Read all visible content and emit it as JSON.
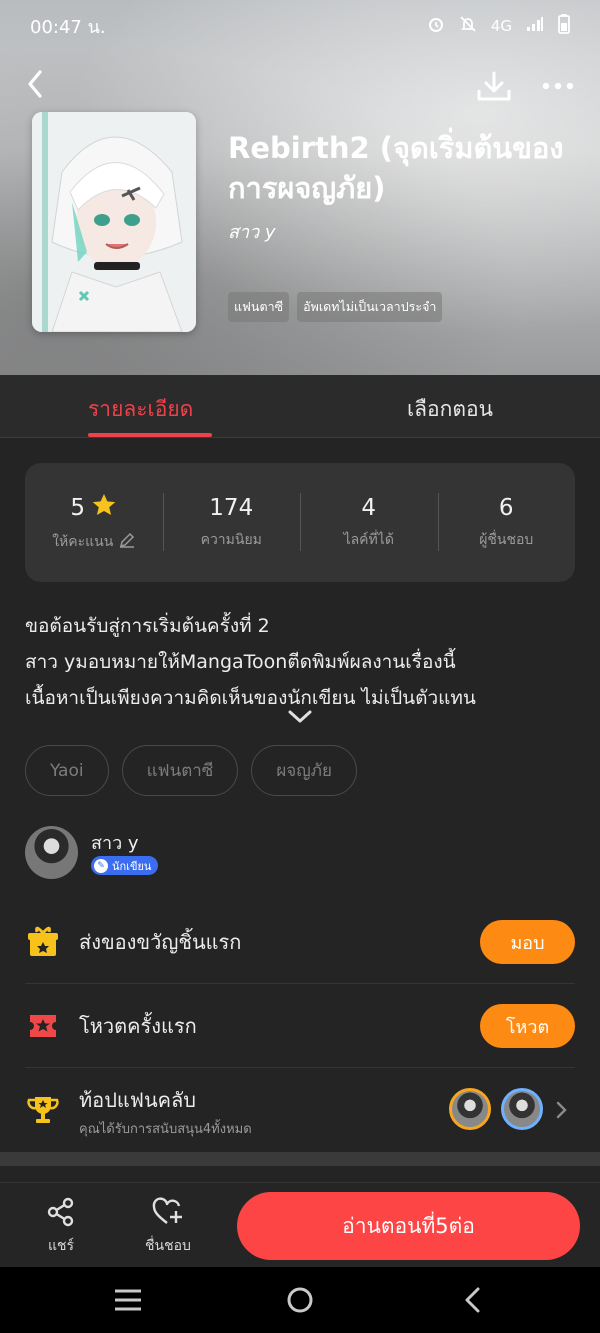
{
  "status_bar": {
    "time": "00:47 น.",
    "network": "4G"
  },
  "comic": {
    "title": "Rebirth2 (จุดเริ่มต้นของการผจญภัย)",
    "author": "สาว y",
    "tags": [
      "แฟนตาซี",
      "อัพเดทไม่เป็นเวลาประจำ"
    ]
  },
  "tabs": [
    {
      "label": "รายละเอียด",
      "active": true
    },
    {
      "label": "เลือกตอน",
      "active": false
    }
  ],
  "stats": [
    {
      "value": "5",
      "label": "ให้คะแนน"
    },
    {
      "value": "174",
      "label": "ความนิยม"
    },
    {
      "value": "4",
      "label": "ไลค์ที่ได้"
    },
    {
      "value": "6",
      "label": "ผู้ชื่นชอบ"
    }
  ],
  "description": [
    "ขอต้อนรับสู่การเริ่มต้นครั้งที่ 2",
    "สาว yมอบหมายให้MangaToonตีดพิมพ์ผลงานเรื่องนี้",
    "เนื้อหาเป็นเพียงความคิดเห็นของนักเขียน ไม่เป็นตัวแทน"
  ],
  "genres": [
    "Yaoi",
    "แฟนตาซี",
    "ผจญภัย"
  ],
  "author_card": {
    "name": "สาว y",
    "badge": "นักเขียน"
  },
  "actions": {
    "gift": {
      "label": "ส่งของขวัญชิ้นแรก",
      "button": "มอบ"
    },
    "vote": {
      "label": "โหวตครั้งแรก",
      "button": "โหวต"
    },
    "fanclub": {
      "label": "ท้อปแฟนคลับ",
      "sub": "คุณได้รับการสนับสนุน4ทั้งหมด"
    }
  },
  "bottom_bar": {
    "share": "แชร์",
    "like": "ชื่นชอบ",
    "read": "อ่านตอนที่5ต่อ"
  },
  "colors": {
    "accent_red": "#f0404a",
    "orange_button": "#fd8a13",
    "read_button": "#fe4545",
    "background": "#242424"
  }
}
